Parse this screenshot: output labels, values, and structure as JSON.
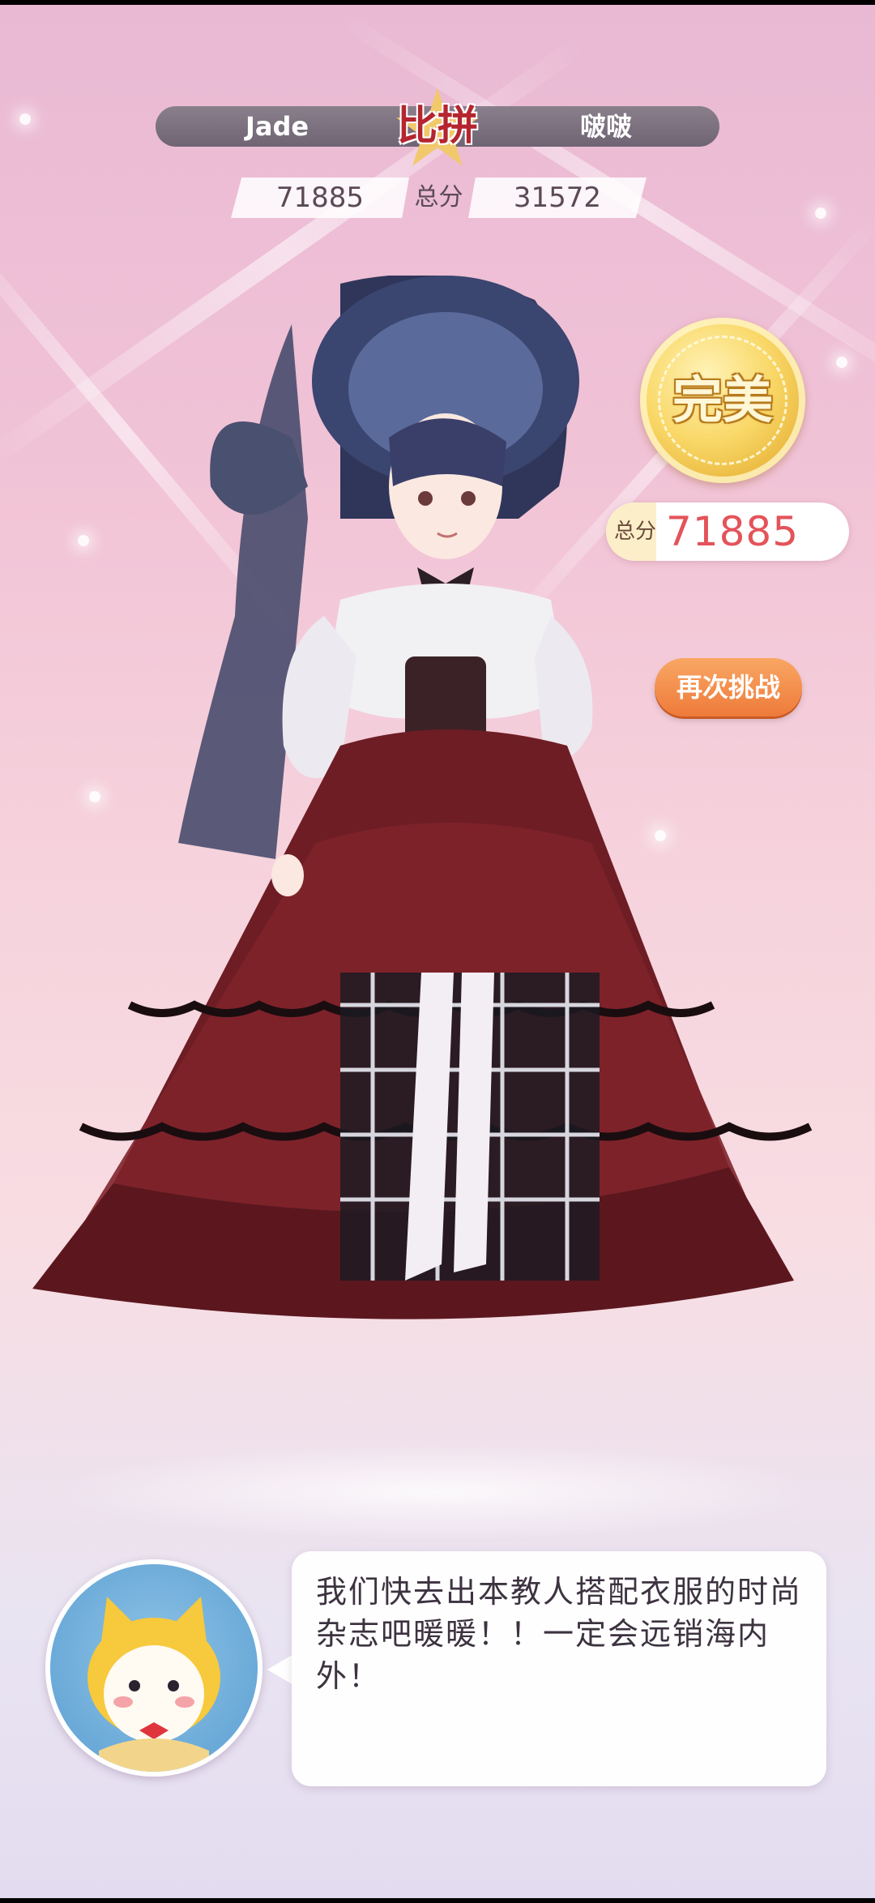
{
  "versus": {
    "title": "比拼",
    "left_player": "Jade",
    "right_player": "啵啵",
    "left_score": "71885",
    "right_score": "31572",
    "total_label": "总分"
  },
  "result": {
    "rating": "完美",
    "total_label": "总分",
    "total_value": "71885"
  },
  "actions": {
    "retry_label": "再次挑战"
  },
  "dialog": {
    "text": "我们快去出本教人搭配衣服的时尚杂志吧暖暖！！一定会远销海内外！"
  },
  "colors": {
    "accent_red": "#e4535a",
    "retry_orange": "#ee7a3a",
    "medal_gold": "#f9d868"
  }
}
